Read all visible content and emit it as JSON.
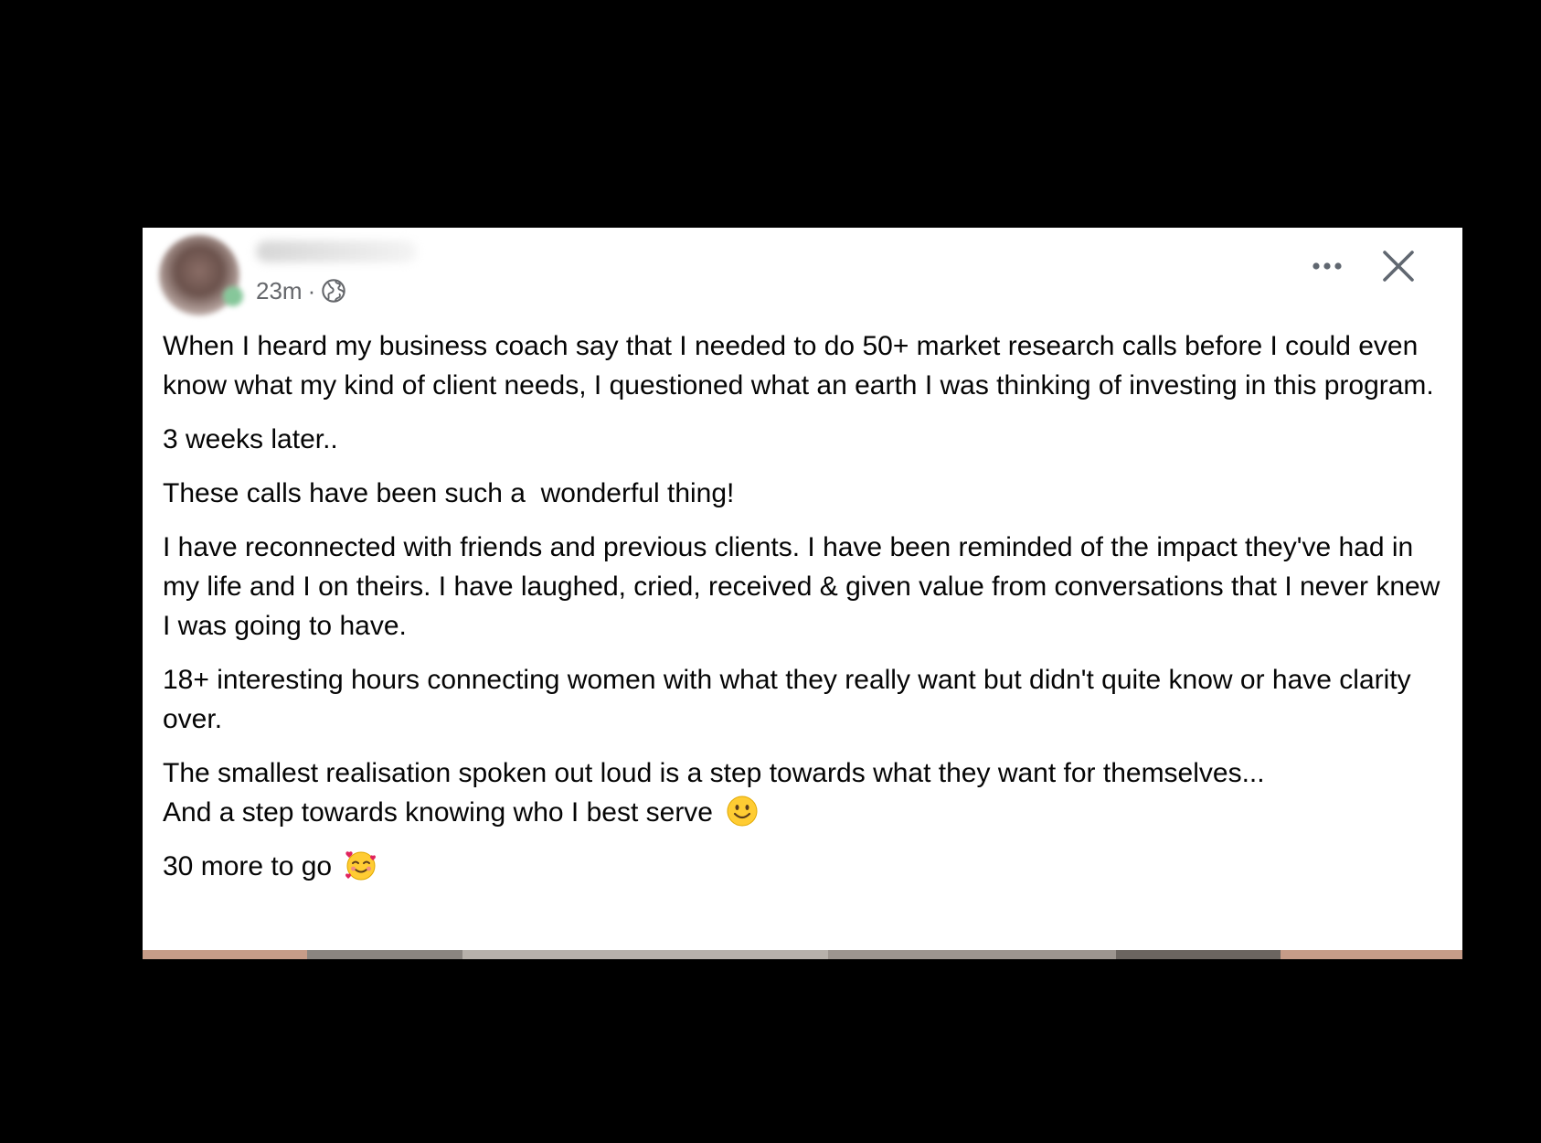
{
  "post": {
    "timestamp": "23m",
    "separator": "·",
    "visibility_icon": "globe-icon",
    "actions": {
      "more_icon": "more-options-icon",
      "close_icon": "close-icon"
    },
    "paragraphs": [
      "When I heard my business coach say that I needed to do 50+ market research calls before I could even know what my kind of client needs, I questioned what an earth I was thinking of investing in this program.",
      "3 weeks later..",
      "These calls have been such a  wonderful thing!",
      "I have reconnected with friends and previous clients. I have been reminded of the impact they've had in my life and I on theirs. I have laughed, cried, received & given value from conversations that I never knew I was going to have.",
      "18+ interesting hours connecting women with what they really want but didn't quite know or have clarity over."
    ],
    "paragraph_6_line_1": "The smallest realisation spoken out loud is a step towards what they want for themselves...",
    "paragraph_6_line_2": "And a step towards knowing who I best serve",
    "paragraph_6_emoji": "smiling-face-emoji",
    "paragraph_7_text": "30 more to go",
    "paragraph_7_emoji": "smiling-face-with-hearts-emoji"
  },
  "colors": {
    "background": "#000000",
    "card": "#ffffff",
    "text_primary": "#050505",
    "text_secondary": "#65676b",
    "icon": "#606770"
  }
}
